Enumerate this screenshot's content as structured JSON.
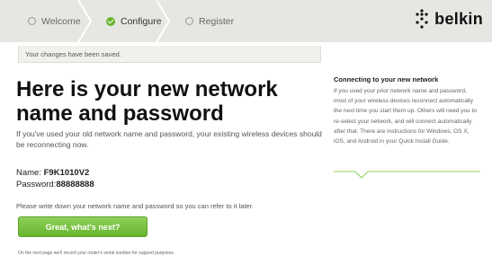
{
  "steps": {
    "welcome": "Welcome",
    "configure": "Configure",
    "register": "Register"
  },
  "brand": {
    "name": "belkin",
    "accent": "#67b52e"
  },
  "status": {
    "message": "Your changes have been saved."
  },
  "main": {
    "title": "Here is your new network name and password",
    "description": "If you've used your old network name and password, your existing wireless devices should be reconnecting now.",
    "network_name_label": "Name:",
    "network_name_value": "F9K1010V2",
    "password_label": "Password:",
    "password_value": "88888888",
    "note": "Please write down your network name and password so you can refer to it later.",
    "next_button": "Great, what's next?",
    "footnote": "On the next page we'll record your router's serial number for support purposes."
  },
  "info_panel": {
    "title": "Connecting to your new network",
    "body": "If you used your prior network name and password, most of your wireless devices reconnect automatically the next time you start them up. Others will need you to re-select your network, and will connect automatically after that. There are instructions for Windows, OS X, iOS, and Android in your Quick Install Guide."
  }
}
